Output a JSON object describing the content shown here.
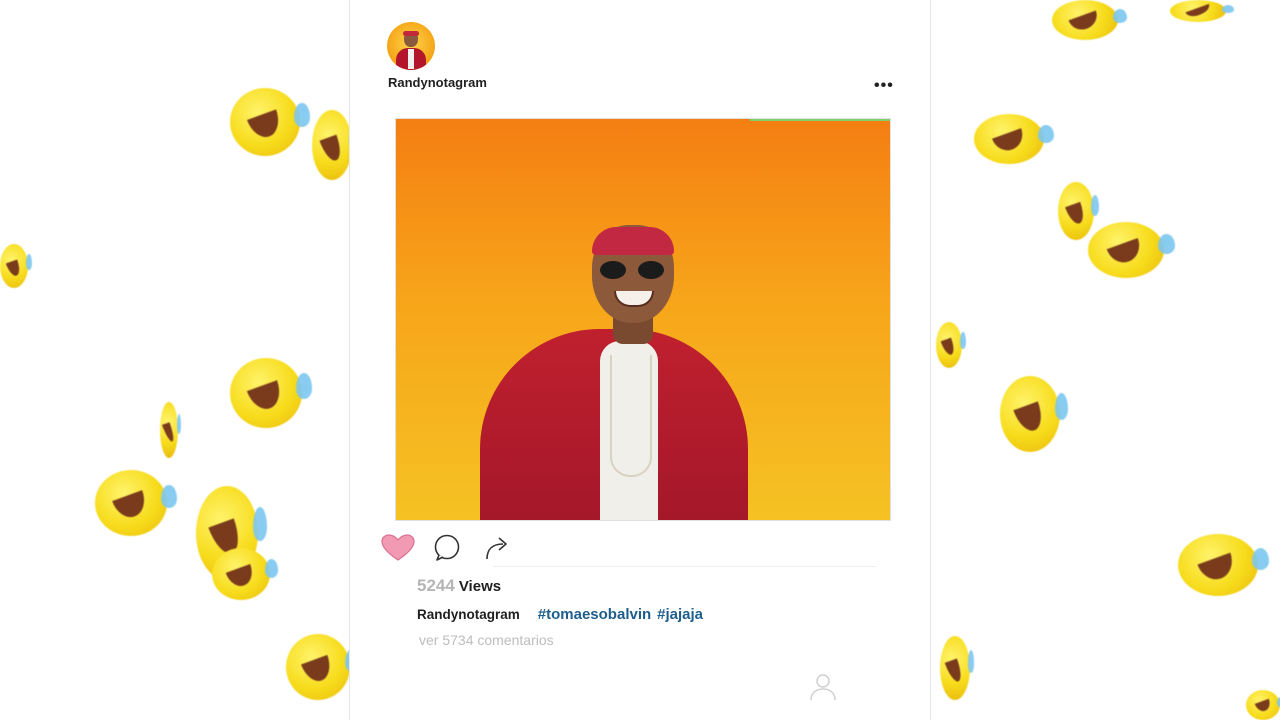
{
  "post": {
    "username": "Randynotagram",
    "more_label": "•••",
    "views_count": "5244",
    "views_label": "Views",
    "caption_user": "Randynotagram",
    "hashtags": [
      "#tomaesobalvin",
      "#jajaja"
    ],
    "comments_link": "ver 5734 comentarios"
  },
  "icons": {
    "like": "heart-icon",
    "comment": "comment-bubble-icon",
    "share": "share-arrow-icon",
    "profile": "profile-person-icon",
    "background": "laughing-tears-emoji"
  },
  "colors": {
    "like_fill": "#f29ab4",
    "hashtag": "#1f5e8c",
    "muted": "#bdbdbd",
    "media_top": "#f47e12",
    "media_bottom": "#f5c223"
  }
}
